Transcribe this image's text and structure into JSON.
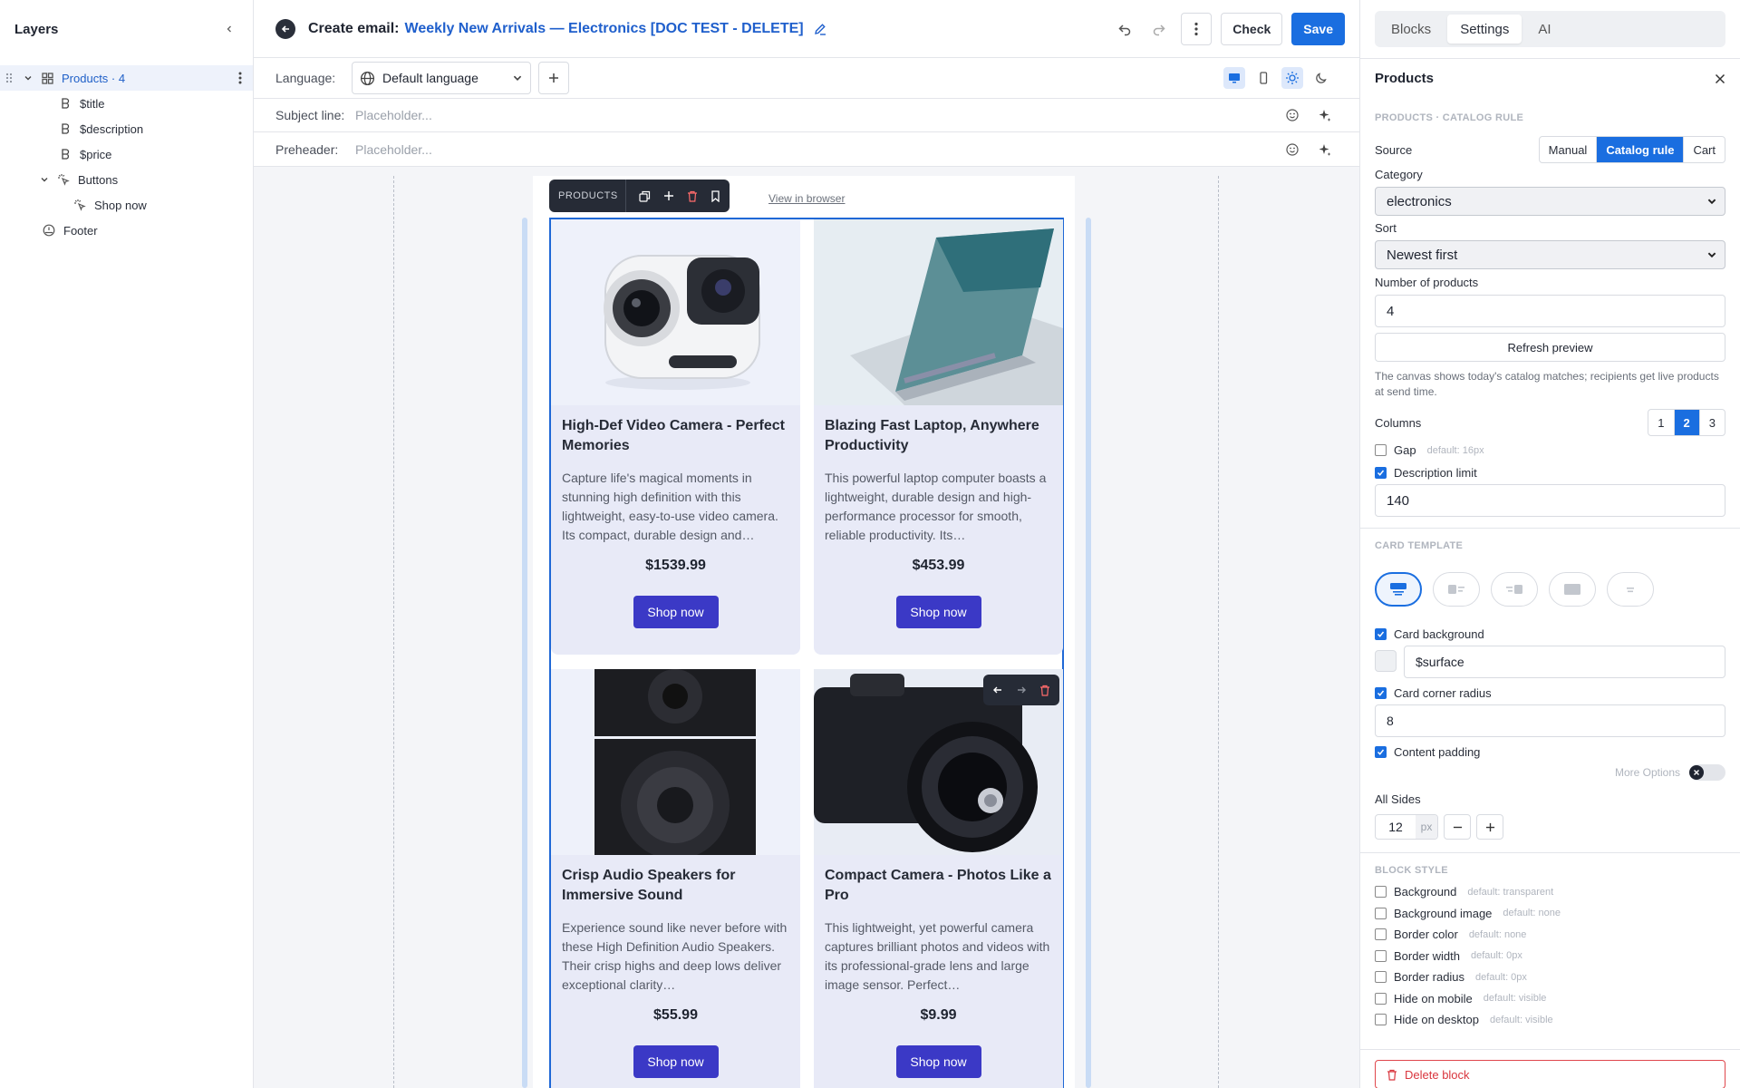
{
  "layers": {
    "title": "Layers",
    "items": [
      {
        "label": "Products · 4"
      },
      {
        "label": "$title"
      },
      {
        "label": "$description"
      },
      {
        "label": "$price"
      },
      {
        "label": "Buttons"
      },
      {
        "label": "Shop now"
      },
      {
        "label": "Footer"
      }
    ]
  },
  "topbar": {
    "title_label": "Create email:",
    "title_value": "Weekly New Arrivals — Electronics [DOC TEST - DELETE]",
    "check": "Check",
    "save": "Save"
  },
  "meta": {
    "language_label": "Language:",
    "language_value": "Default language",
    "subject_label": "Subject line:",
    "subject_placeholder": "Placeholder...",
    "preheader_label": "Preheader:",
    "preheader_placeholder": "Placeholder..."
  },
  "canvas": {
    "toolbar_label": "PRODUCTS",
    "view_in_browser": "View in browser",
    "products": [
      {
        "title": "High-Def Video Camera - Perfect Memories",
        "desc": "Capture life's magical moments in stunning high definition with this lightweight, easy-to-use video camera. Its compact, durable design and…",
        "price": "$1539.99",
        "button": "Shop now"
      },
      {
        "title": "Blazing Fast Laptop, Anywhere Productivity",
        "desc": "This powerful laptop computer boasts a lightweight, durable design and high-performance processor for smooth, reliable productivity. Its…",
        "price": "$453.99",
        "button": "Shop now"
      },
      {
        "title": "Crisp Audio Speakers for Immersive Sound",
        "desc": "Experience sound like never before with these High Definition Audio Speakers. Their crisp highs and deep lows deliver exceptional clarity…",
        "price": "$55.99",
        "button": "Shop now"
      },
      {
        "title": "Compact Camera - Photos Like a Pro",
        "desc": "This lightweight, yet powerful camera captures brilliant photos and videos with its professional-grade lens and large image sensor. Perfect…",
        "price": "$9.99",
        "button": "Shop now"
      }
    ]
  },
  "panel": {
    "tabs": [
      "Blocks",
      "Settings",
      "AI"
    ],
    "title": "Products",
    "section_catalog": "PRODUCTS · CATALOG RULE",
    "source_label": "Source",
    "source_options": [
      "Manual",
      "Catalog rule",
      "Cart"
    ],
    "category_label": "Category",
    "category_value": "electronics",
    "sort_label": "Sort",
    "sort_value": "Newest first",
    "count_label": "Number of products",
    "count_value": "4",
    "refresh": "Refresh preview",
    "hint": "The canvas shows today's catalog matches; recipients get live products at send time.",
    "columns_label": "Columns",
    "columns_options": [
      "1",
      "2",
      "3"
    ],
    "gap_label": "Gap",
    "gap_default": "default: 16px",
    "desc_limit_label": "Description limit",
    "desc_limit_value": "140",
    "section_card": "CARD TEMPLATE",
    "card_bg_label": "Card background",
    "card_bg_value": "$surface",
    "card_radius_label": "Card corner radius",
    "card_radius_value": "8",
    "content_padding_label": "Content padding",
    "more_options": "More Options",
    "all_sides_label": "All Sides",
    "all_sides_value": "12",
    "all_sides_unit": "px",
    "section_block": "BLOCK STYLE",
    "block_styles": [
      {
        "label": "Background",
        "default": "default: transparent"
      },
      {
        "label": "Background image",
        "default": "default: none"
      },
      {
        "label": "Border color",
        "default": "default: none"
      },
      {
        "label": "Border width",
        "default": "default: 0px"
      },
      {
        "label": "Border radius",
        "default": "default: 0px"
      },
      {
        "label": "Hide on mobile",
        "default": "default: visible"
      },
      {
        "label": "Hide on desktop",
        "default": "default: visible"
      }
    ],
    "delete": "Delete block"
  }
}
